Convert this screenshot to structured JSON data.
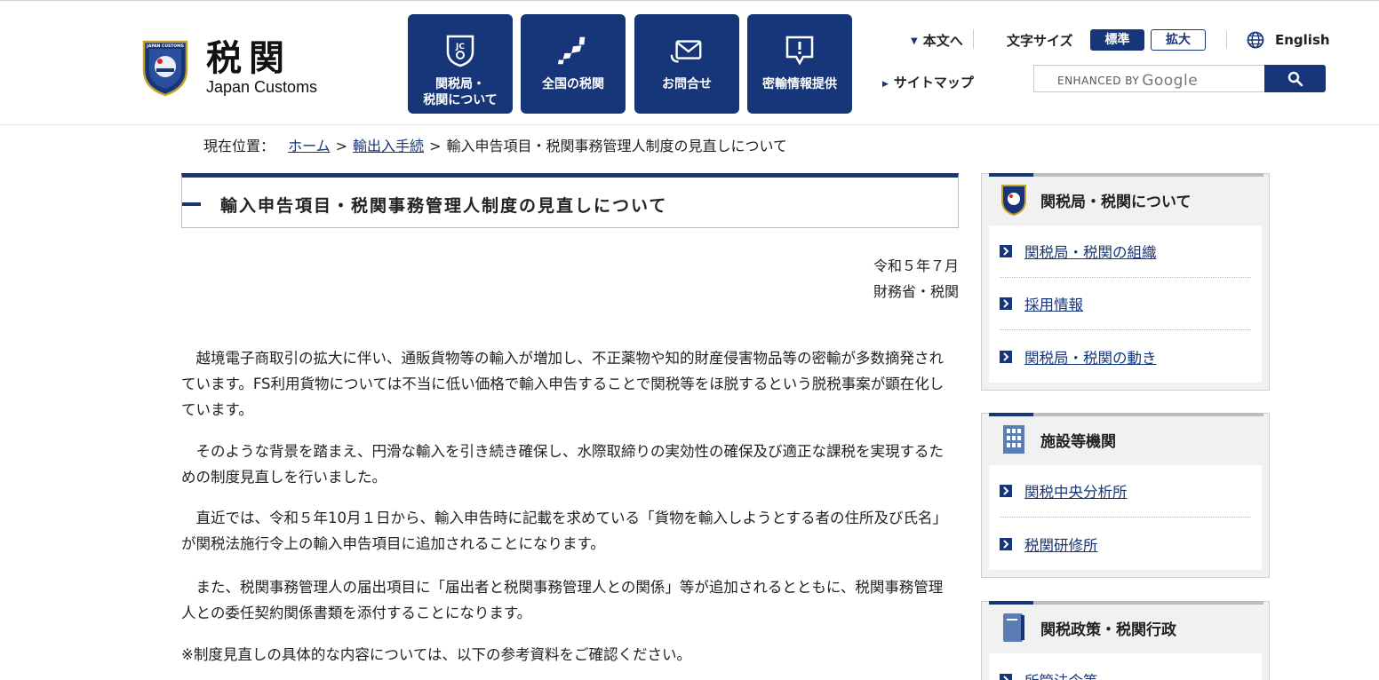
{
  "header": {
    "logo_kanji": "税関",
    "logo_en": "Japan Customs",
    "emblem_text": "JAPAN CUSTOMS",
    "nav": [
      {
        "label": "関税局・\n税関について",
        "icon": "jc-badge-icon"
      },
      {
        "label": "全国の税関",
        "icon": "japan-map-icon"
      },
      {
        "label": "お問合せ",
        "icon": "envelope-icon"
      },
      {
        "label": "密輸情報提供",
        "icon": "alert-speech-icon"
      }
    ],
    "skip_link": "本文へ",
    "font_size_label": "文字サイズ",
    "font_standard": "標準",
    "font_large": "拡大",
    "language": "English",
    "sitemap": "サイトマップ",
    "search_placeholder_prefix": "ENHANCED BY",
    "search_placeholder_brand": "Google",
    "accent_color": "#17367a"
  },
  "breadcrumb": {
    "prefix": "現在位置：",
    "home": "ホーム",
    "section": "輸出入手続",
    "current": "輸入申告項目・税関事務管理人制度の見直しについて"
  },
  "main": {
    "title": "輸入申告項目・税関事務管理人制度の見直しについて",
    "date": "令和５年７月",
    "issuer": "財務省・税関",
    "paragraphs": [
      "越境電子商取引の拡大に伴い、通販貨物等の輸入が増加し、不正薬物や知的財産侵害物品等の密輸が多数摘発されています。FS利用貨物については不当に低い価格で輸入申告することで関税等をほ脱するという脱税事案が顕在化しています。",
      "そのような背景を踏まえ、円滑な輸入を引き続き確保し、水際取締りの実効性の確保及び適正な課税を実現するための制度見直しを行いました。",
      "直近では、令和５年10月１日から、輸入申告時に記載を求めている「貨物を輸入しようとする者の住所及び氏名」が関税法施行令上の輸入申告項目に追加されることになります。",
      "また、税関事務管理人の届出項目に「届出者と税関事務管理人との関係」等が追加されるとともに、税関事務管理人との委任契約関係書類を添付することになります。"
    ],
    "note": "※制度見直しの具体的な内容については、以下の参考資料をご確認ください。"
  },
  "sidebar": {
    "boxes": [
      {
        "title": "関税局・税関について",
        "icon": "customs-emblem-icon",
        "items": [
          "関税局・税関の組織",
          "採用情報",
          "関税局・税関の動き"
        ]
      },
      {
        "title": "施設等機関",
        "icon": "building-icon",
        "items": [
          "関税中央分析所",
          "税関研修所"
        ]
      },
      {
        "title": "関税政策・税関行政",
        "icon": "book-icon",
        "items": [
          "所管法令等"
        ]
      }
    ]
  }
}
